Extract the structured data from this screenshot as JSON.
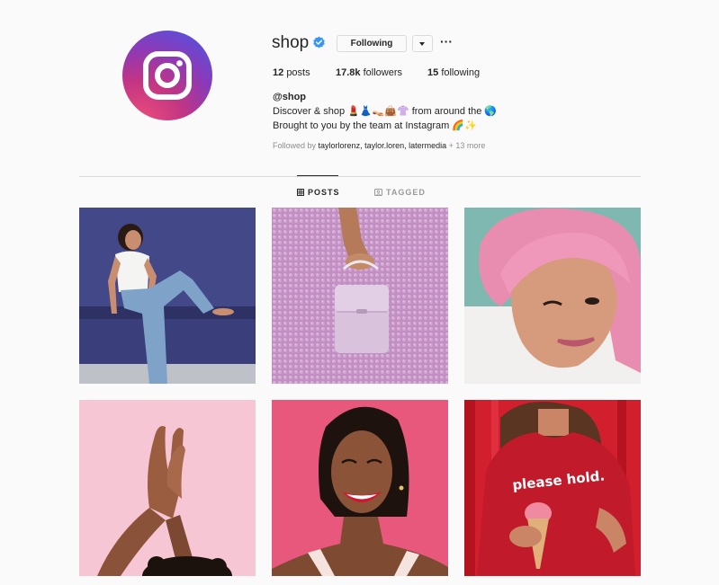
{
  "profile": {
    "username": "shop",
    "follow_label": "Following",
    "more_label": "···",
    "posts_count": "12",
    "posts_label": "posts",
    "followers_count": "17.8k",
    "followers_label": "followers",
    "following_count": "15",
    "following_label": "following",
    "bio_name": "@shop",
    "bio_line1_prefix": "Discover & shop",
    "bio_line1_emojis": "💄👗👡👜👚",
    "bio_line1_suffix": "from around the",
    "bio_line1_globe": "🌎",
    "bio_line2_text": "Brought to you by the team at Instagram",
    "bio_line2_emojis": "🌈✨",
    "followed_by_prefix": "Followed by",
    "followed_by_names": "taylorlorenz, taylor.loren, latermedia",
    "followed_by_more": "+ 13 more"
  },
  "tabs": {
    "posts": "POSTS",
    "tagged": "TAGGED"
  },
  "colors": {
    "accent": "#3897f0",
    "border": "#dbdbdb",
    "muted": "#8e8e8e",
    "background": "#fafafa"
  },
  "icons": {
    "verified": "verified-badge-icon",
    "instagram": "instagram-camera-icon",
    "grid": "grid-icon",
    "tagged": "tagged-icon",
    "dropdown": "chevron-down-icon",
    "more": "more-icon"
  },
  "posts": [
    {
      "subject": "woman in white tee and jeans sitting on a blue bench"
    },
    {
      "subject": "hand holding lavender purse over lilac beads"
    },
    {
      "subject": "woman with pink bob hair winking"
    },
    {
      "subject": "clapping hands on pink background"
    },
    {
      "subject": "smiling woman with red lipstick on pink background"
    },
    {
      "subject": "woman in red please hold sweatshirt holding ice cream"
    }
  ],
  "post_texts": {
    "sweatshirt_text": "please hold."
  }
}
